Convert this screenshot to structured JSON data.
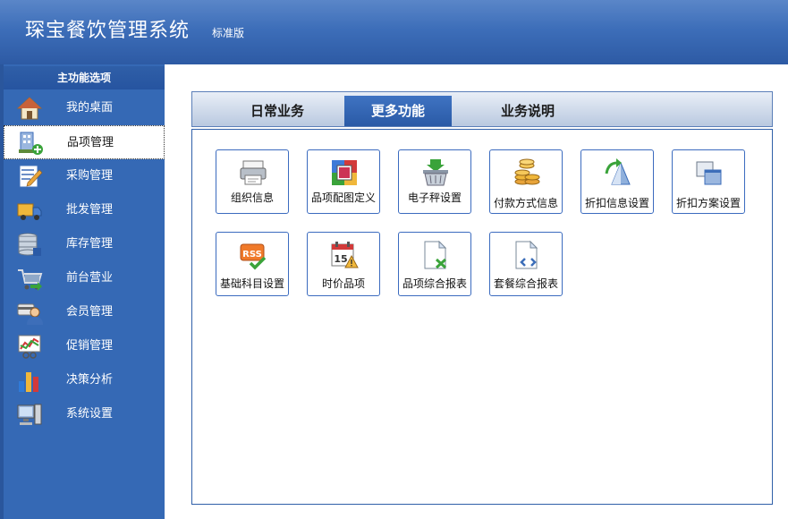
{
  "app": {
    "title": "琛宝餐饮管理系统",
    "edition": "标准版"
  },
  "sidebar": {
    "heading": "主功能选项",
    "items": [
      {
        "label": "我的桌面",
        "icon": "house-icon"
      },
      {
        "label": "品项管理",
        "icon": "building-add-icon",
        "active": true
      },
      {
        "label": "采购管理",
        "icon": "form-pencil-icon"
      },
      {
        "label": "批发管理",
        "icon": "truck-icon"
      },
      {
        "label": "库存管理",
        "icon": "database-icon"
      },
      {
        "label": "前台营业",
        "icon": "shopping-cart-icon"
      },
      {
        "label": "会员管理",
        "icon": "member-card-icon"
      },
      {
        "label": "促销管理",
        "icon": "chart-board-icon"
      },
      {
        "label": "决策分析",
        "icon": "bar-chart-icon"
      },
      {
        "label": "系统设置",
        "icon": "computer-icon"
      }
    ]
  },
  "tabs": [
    {
      "label": "日常业务",
      "active": false
    },
    {
      "label": "更多功能",
      "active": true
    },
    {
      "label": "业务说明",
      "active": false
    }
  ],
  "tiles": [
    {
      "label": "组织信息",
      "icon": "printer-icon"
    },
    {
      "label": "品项配图定义",
      "icon": "image-palette-icon"
    },
    {
      "label": "电子秤设置",
      "icon": "basket-download-icon"
    },
    {
      "label": "付款方式信息",
      "icon": "coins-icon"
    },
    {
      "label": "折扣信息设置",
      "icon": "triangle-arrow-icon"
    },
    {
      "label": "折扣方案设置",
      "icon": "windows-stack-icon"
    },
    {
      "label": "基础科目设置",
      "icon": "rss-check-icon"
    },
    {
      "label": "时价品项",
      "icon": "calendar-warning-icon"
    },
    {
      "label": "品项综合报表",
      "icon": "document-excel-icon"
    },
    {
      "label": "套餐综合报表",
      "icon": "document-arrows-icon"
    }
  ],
  "colors": {
    "header": "#3d6eb9",
    "sidebar": "#3569b5",
    "accent": "#2a5aa6"
  }
}
